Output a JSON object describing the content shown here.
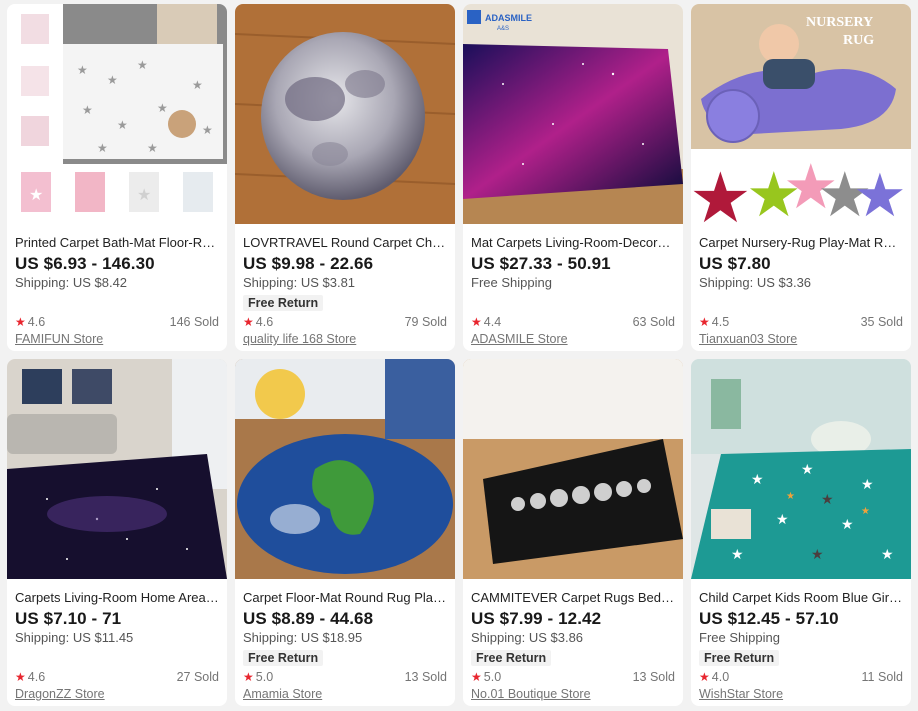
{
  "products": [
    {
      "title": "Printed Carpet Bath-Mat Floor-Rug...",
      "price": "US $6.93 - 146.30",
      "shipping": "Shipping: US $8.42",
      "badge": "",
      "rating": "4.6",
      "sold": "146 Sold",
      "store": "FAMIFUN Store",
      "image": "star-rug-collage-image"
    },
    {
      "title": "LOVRTRAVEL Round Carpet Chair-...",
      "price": "US $9.98 - 22.66",
      "shipping": "Shipping: US $3.81",
      "badge": "Free Return",
      "rating": "4.6",
      "sold": "79 Sold",
      "store": "quality life 168 Store",
      "image": "moon-rug-image"
    },
    {
      "title": "Mat Carpets Living-Room-Decorati...",
      "price": "US $27.33 - 50.91",
      "shipping": "Free Shipping",
      "badge": "",
      "rating": "4.4",
      "sold": "63 Sold",
      "store": "ADASMILE Store",
      "image": "galaxy-rug-image",
      "overlay_text": "ADASMILE A&S"
    },
    {
      "title": "Carpet Nursery-Rug Play-Mat Roo...",
      "price": "US $7.80",
      "shipping": "Shipping: US $3.36",
      "badge": "",
      "rating": "4.5",
      "sold": "35 Sold",
      "store": "Tianxuan03 Store",
      "image": "nursery-star-rug-image",
      "overlay_text": "Nursery Rug"
    },
    {
      "title": "Carpets Living-Room Home Area-R...",
      "price": "US $7.10 - 71",
      "shipping": "Shipping: US $11.45",
      "badge": "",
      "rating": "4.6",
      "sold": "27 Sold",
      "store": "DragonZZ Store",
      "image": "galaxy-livingroom-rug-image"
    },
    {
      "title": "Carpet Floor-Mat Round Rug Plane...",
      "price": "US $8.89 - 44.68",
      "shipping": "Shipping: US $18.95",
      "badge": "Free Return",
      "rating": "5.0",
      "sold": "13 Sold",
      "store": "Amamia Store",
      "image": "earth-rug-image"
    },
    {
      "title": "CAMMITEVER Carpet Rugs Bedroo...",
      "price": "US $7.99 - 12.42",
      "shipping": "Shipping: US $3.86",
      "badge": "Free Return",
      "rating": "5.0",
      "sold": "13 Sold",
      "store": "No.01 Boutique Store",
      "image": "moon-phases-rug-image"
    },
    {
      "title": "Child Carpet Kids Room Blue Girls ...",
      "price": "US $12.45 - 57.10",
      "shipping": "Free Shipping",
      "badge": "Free Return",
      "rating": "4.0",
      "sold": "11 Sold",
      "store": "WishStar Store",
      "image": "teal-star-rug-image"
    }
  ]
}
